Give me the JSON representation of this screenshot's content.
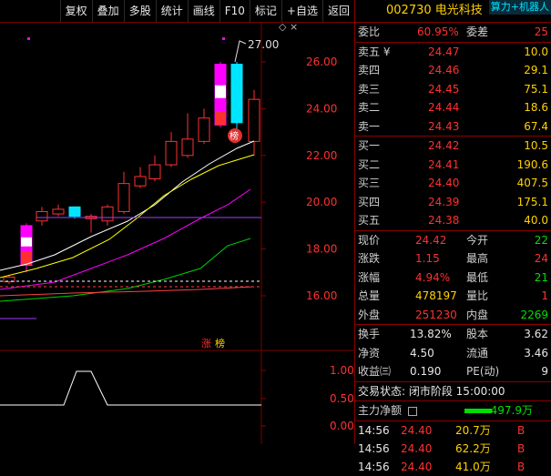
{
  "toolbar": {
    "items": [
      "复权",
      "叠加",
      "多股",
      "统计",
      "画线",
      "F10",
      "标记",
      "+自选",
      "返回"
    ]
  },
  "chart": {
    "y_ticks": [
      "26.00",
      "24.00",
      "22.00",
      "20.00",
      "18.00",
      "16.00"
    ],
    "annotation_high": "27.00",
    "tag_zhang": "涨",
    "tag_bang": "榜",
    "circle_tag": "榜",
    "indicator_ticks": [
      "1.00",
      "0.50",
      "0.00"
    ],
    "colors": {
      "up": "#ff3030",
      "down": "#00e5ff",
      "ma1": "#ffffff",
      "ma2": "#ffff00",
      "ma3": "#ff00ff",
      "ma4": "#00d000",
      "magenta": "#ff00ff"
    }
  },
  "panel": {
    "title": "002730 电光科技",
    "badge": "算力+机器人",
    "weibi": {
      "label": "委比",
      "value": "60.95%",
      "label2": "委差",
      "value2": "25"
    },
    "asks": [
      {
        "label": "卖五 ¥",
        "price": "24.47",
        "vol": "10.0"
      },
      {
        "label": "卖四",
        "price": "24.46",
        "vol": "29.1"
      },
      {
        "label": "卖三",
        "price": "24.45",
        "vol": "75.1"
      },
      {
        "label": "卖二",
        "price": "24.44",
        "vol": "18.6"
      },
      {
        "label": "卖一",
        "price": "24.43",
        "vol": "67.4"
      }
    ],
    "bids": [
      {
        "label": "买一",
        "price": "24.42",
        "vol": "10.5"
      },
      {
        "label": "买二",
        "price": "24.41",
        "vol": "190.6"
      },
      {
        "label": "买三",
        "price": "24.40",
        "vol": "407.5"
      },
      {
        "label": "买四",
        "price": "24.39",
        "vol": "175.1"
      },
      {
        "label": "买五",
        "price": "24.38",
        "vol": "40.0"
      }
    ],
    "quote": [
      {
        "l1": "现价",
        "v1": "24.42",
        "c1": "red",
        "l2": "今开",
        "v2": "22",
        "c2": "green"
      },
      {
        "l1": "涨跌",
        "v1": "1.15",
        "c1": "red",
        "l2": "最高",
        "v2": "24",
        "c2": "red"
      },
      {
        "l1": "涨幅",
        "v1": "4.94%",
        "c1": "red",
        "l2": "最低",
        "v2": "21",
        "c2": "green"
      },
      {
        "l1": "总量",
        "v1": "478197",
        "c1": "yellow",
        "l2": "量比",
        "v2": "1",
        "c2": "red"
      },
      {
        "l1": "外盘",
        "v1": "251230",
        "c1": "red",
        "l2": "内盘",
        "v2": "2269",
        "c2": "green"
      }
    ],
    "stats": [
      {
        "l1": "换手",
        "v1": "13.82%",
        "l2": "股本",
        "v2": "3.62"
      },
      {
        "l1": "净资",
        "v1": "4.50",
        "l2": "流通",
        "v2": "3.46"
      },
      {
        "l1": "收益㈢",
        "v1": "0.190",
        "l2": "PE(动)",
        "v2": "9"
      }
    ],
    "status": "交易状态: 闭市阶段 15:00:00",
    "main_flow_label": "主力净额",
    "main_flow_value": "-497.9万",
    "trades": [
      {
        "time": "14:56",
        "price": "24.40",
        "vol": "20.7万",
        "side": "B"
      },
      {
        "time": "14:56",
        "price": "24.40",
        "vol": "62.2万",
        "side": "B"
      },
      {
        "time": "14:56",
        "price": "24.40",
        "vol": "41.0万",
        "side": "B"
      }
    ]
  }
}
